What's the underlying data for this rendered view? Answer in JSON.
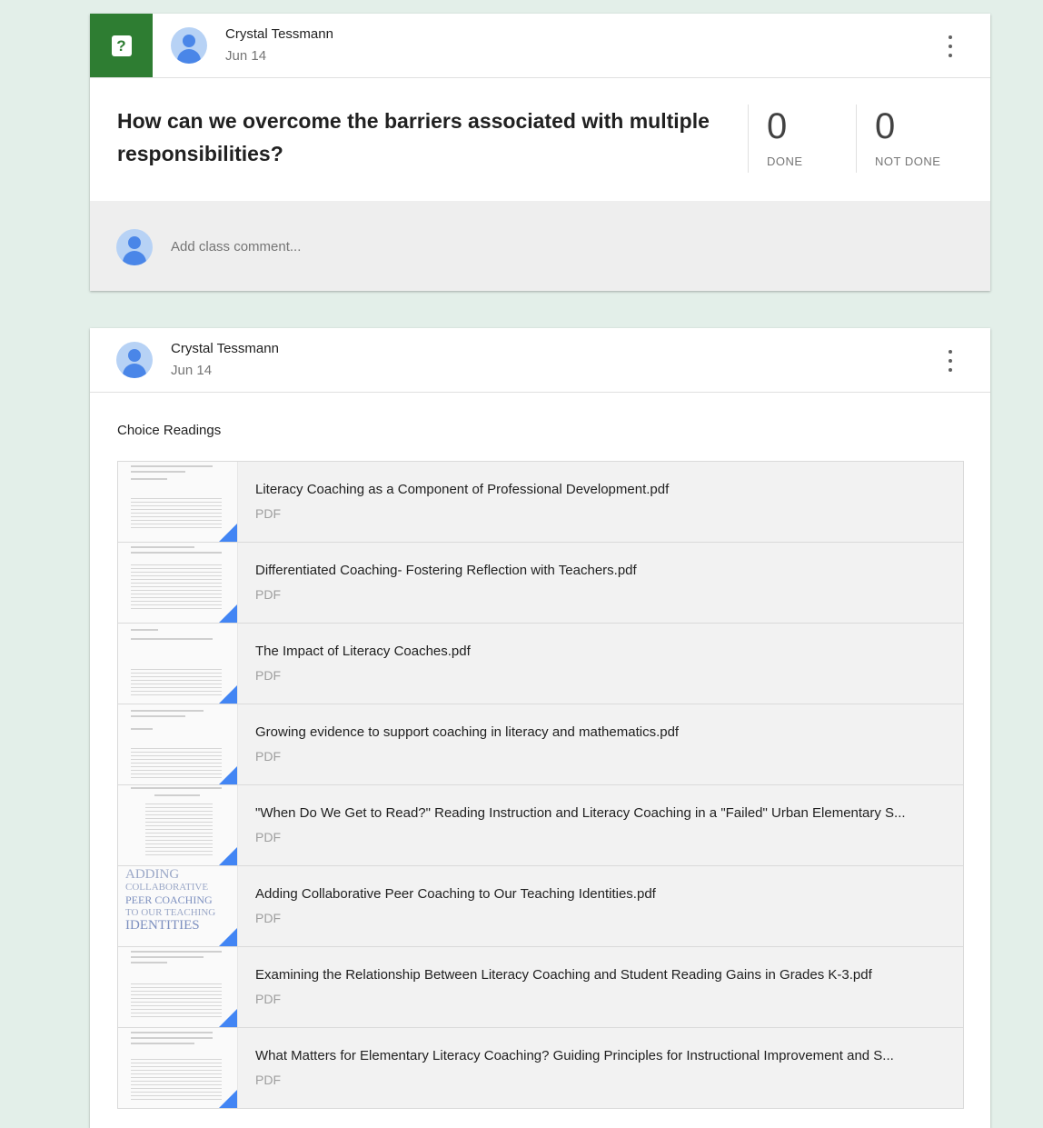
{
  "card1": {
    "author": "Crystal Tessmann",
    "date": "Jun 14",
    "question": "How can we overcome the barriers associated with multiple responsibilities?",
    "stats": [
      {
        "value": "0",
        "label": "DONE"
      },
      {
        "value": "0",
        "label": "NOT DONE"
      }
    ],
    "comment_placeholder": "Add class comment..."
  },
  "card2": {
    "author": "Crystal Tessmann",
    "date": "Jun 14",
    "section_title": "Choice Readings",
    "attachments": [
      {
        "title": "Literacy Coaching as a Component of Professional Development.pdf",
        "type": "PDF"
      },
      {
        "title": "Differentiated Coaching- Fostering Reflection with Teachers.pdf",
        "type": "PDF"
      },
      {
        "title": "The Impact of Literacy Coaches.pdf",
        "type": "PDF"
      },
      {
        "title": "Growing evidence to support coaching in literacy and mathematics.pdf",
        "type": "PDF"
      },
      {
        "title": "\"When Do We Get to Read?\" Reading Instruction and Literacy Coaching in a \"Failed\" Urban Elementary S...",
        "type": "PDF"
      },
      {
        "title": "Adding Collaborative Peer Coaching to Our Teaching Identities.pdf",
        "type": "PDF"
      },
      {
        "title": "Examining the Relationship Between Literacy Coaching and Student Reading Gains in Grades K-3.pdf",
        "type": "PDF"
      },
      {
        "title": "What Matters for Elementary Literacy Coaching? Guiding Principles for Instructional Improvement and S...",
        "type": "PDF"
      }
    ],
    "cover_text": [
      "ADDING",
      "COLLABORATIVE",
      "PEER COACHING",
      "TO OUR TEACHING",
      "IDENTITIES"
    ]
  },
  "colors": {
    "question_badge": "#2e7d32",
    "avatar": "#4a86e8",
    "drive_corner": "#4285f4",
    "background": "#e3efe9"
  },
  "icons": {
    "question_badge": "question-icon",
    "more": "more-vert-icon",
    "avatar": "person-icon",
    "attachment_corner": "drive-file-icon"
  }
}
